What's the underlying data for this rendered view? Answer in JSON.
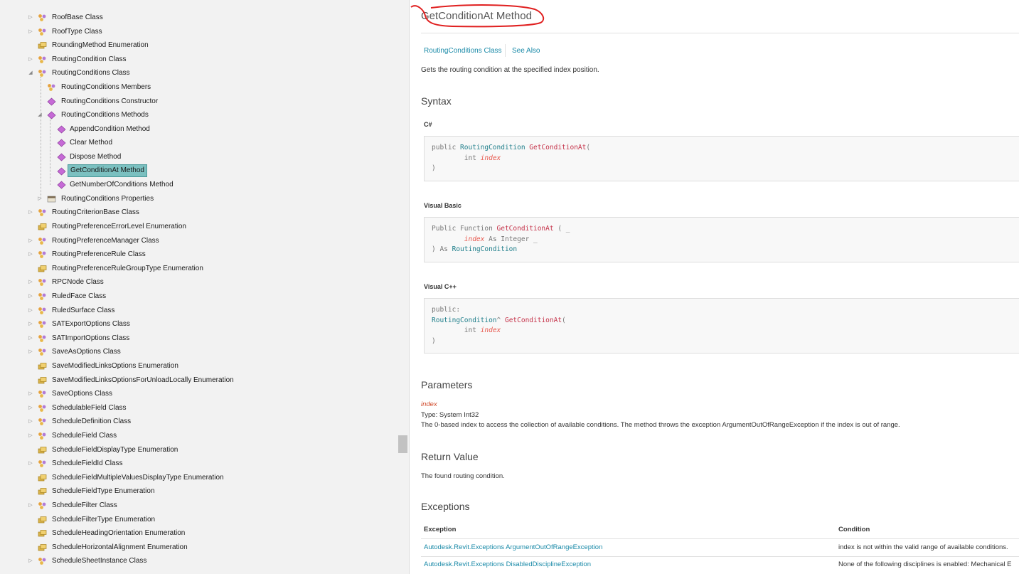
{
  "sidebar": {
    "items": [
      {
        "label": "RoofBase Class",
        "icon": "class-icon",
        "toggle": "▷",
        "level": 0
      },
      {
        "label": "RoofType Class",
        "icon": "class-icon",
        "toggle": "▷",
        "level": 0
      },
      {
        "label": "RoundingMethod Enumeration",
        "icon": "enum-icon",
        "toggle": "",
        "level": 0
      },
      {
        "label": "RoutingCondition Class",
        "icon": "class-icon",
        "toggle": "▷",
        "level": 0
      },
      {
        "label": "RoutingConditions Class",
        "icon": "class-icon",
        "toggle": "◢",
        "level": 0
      },
      {
        "label": "RoutingConditions Members",
        "icon": "class-icon",
        "toggle": "",
        "level": 1
      },
      {
        "label": "RoutingConditions Constructor",
        "icon": "method-icon",
        "toggle": "",
        "level": 1
      },
      {
        "label": "RoutingConditions Methods",
        "icon": "method-icon",
        "toggle": "◢",
        "level": 1
      },
      {
        "label": "AppendCondition Method",
        "icon": "method-icon",
        "toggle": "",
        "level": 2
      },
      {
        "label": "Clear Method",
        "icon": "method-icon",
        "toggle": "",
        "level": 2
      },
      {
        "label": "Dispose Method",
        "icon": "method-icon",
        "toggle": "",
        "level": 2
      },
      {
        "label": "GetConditionAt Method",
        "icon": "method-icon",
        "toggle": "",
        "level": 2,
        "selected": true
      },
      {
        "label": "GetNumberOfConditions Method",
        "icon": "method-icon",
        "toggle": "",
        "level": 2
      },
      {
        "label": "RoutingConditions Properties",
        "icon": "property-icon",
        "toggle": "▷",
        "level": 1
      },
      {
        "label": "RoutingCriterionBase Class",
        "icon": "class-icon",
        "toggle": "▷",
        "level": 0
      },
      {
        "label": "RoutingPreferenceErrorLevel Enumeration",
        "icon": "enum-icon",
        "toggle": "",
        "level": 0
      },
      {
        "label": "RoutingPreferenceManager Class",
        "icon": "class-icon",
        "toggle": "▷",
        "level": 0
      },
      {
        "label": "RoutingPreferenceRule Class",
        "icon": "class-icon",
        "toggle": "▷",
        "level": 0
      },
      {
        "label": "RoutingPreferenceRuleGroupType Enumeration",
        "icon": "enum-icon",
        "toggle": "",
        "level": 0
      },
      {
        "label": "RPCNode Class",
        "icon": "class-icon",
        "toggle": "▷",
        "level": 0
      },
      {
        "label": "RuledFace Class",
        "icon": "class-icon",
        "toggle": "▷",
        "level": 0
      },
      {
        "label": "RuledSurface Class",
        "icon": "class-icon",
        "toggle": "▷",
        "level": 0
      },
      {
        "label": "SATExportOptions Class",
        "icon": "class-icon",
        "toggle": "▷",
        "level": 0
      },
      {
        "label": "SATImportOptions Class",
        "icon": "class-icon",
        "toggle": "▷",
        "level": 0
      },
      {
        "label": "SaveAsOptions Class",
        "icon": "class-icon",
        "toggle": "▷",
        "level": 0
      },
      {
        "label": "SaveModifiedLinksOptions Enumeration",
        "icon": "enum-icon",
        "toggle": "",
        "level": 0
      },
      {
        "label": "SaveModifiedLinksOptionsForUnloadLocally Enumeration",
        "icon": "enum-icon",
        "toggle": "",
        "level": 0
      },
      {
        "label": "SaveOptions Class",
        "icon": "class-icon",
        "toggle": "▷",
        "level": 0
      },
      {
        "label": "SchedulableField Class",
        "icon": "class-icon",
        "toggle": "▷",
        "level": 0
      },
      {
        "label": "ScheduleDefinition Class",
        "icon": "class-icon",
        "toggle": "▷",
        "level": 0
      },
      {
        "label": "ScheduleField Class",
        "icon": "class-icon",
        "toggle": "▷",
        "level": 0
      },
      {
        "label": "ScheduleFieldDisplayType Enumeration",
        "icon": "enum-icon",
        "toggle": "",
        "level": 0
      },
      {
        "label": "ScheduleFieldId Class",
        "icon": "class-icon",
        "toggle": "▷",
        "level": 0
      },
      {
        "label": "ScheduleFieldMultipleValuesDisplayType Enumeration",
        "icon": "enum-icon",
        "toggle": "",
        "level": 0
      },
      {
        "label": "ScheduleFieldType Enumeration",
        "icon": "enum-icon",
        "toggle": "",
        "level": 0
      },
      {
        "label": "ScheduleFilter Class",
        "icon": "class-icon",
        "toggle": "▷",
        "level": 0
      },
      {
        "label": "ScheduleFilterType Enumeration",
        "icon": "enum-icon",
        "toggle": "",
        "level": 0
      },
      {
        "label": "ScheduleHeadingOrientation Enumeration",
        "icon": "enum-icon",
        "toggle": "",
        "level": 0
      },
      {
        "label": "ScheduleHorizontalAlignment Enumeration",
        "icon": "enum-icon",
        "toggle": "",
        "level": 0
      },
      {
        "label": "ScheduleSheetInstance Class",
        "icon": "class-icon",
        "toggle": "▷",
        "level": 0
      }
    ]
  },
  "page": {
    "title": "GetConditionAt Method",
    "breadcrumb": {
      "parent": "RoutingConditions Class",
      "see_also": "See Also"
    },
    "summary": "Gets the routing condition at the specified index position.",
    "syntax": {
      "heading": "Syntax",
      "csharp": {
        "label": "C#",
        "line1": {
          "kw": "public ",
          "type": "RoutingCondition",
          "name": "GetConditionAt",
          "open": "("
        },
        "line2": {
          "indent": "        ",
          "kw": "int ",
          "param": "index"
        },
        "line3": ")"
      },
      "vb": {
        "label": "Visual Basic",
        "line1": {
          "kw": "Public Function ",
          "name": "GetConditionAt",
          "rest": " ( _"
        },
        "line2": {
          "indent": "        ",
          "param": "index",
          "rest": " As Integer _"
        },
        "line3": {
          "kw": ") As ",
          "type": "RoutingCondition"
        }
      },
      "cpp": {
        "label": "Visual C++",
        "line1": "public:",
        "line2": {
          "type": "RoutingCondition",
          "hat": "^ ",
          "name": "GetConditionAt",
          "open": "("
        },
        "line3": {
          "indent": "        ",
          "kw": "int ",
          "param": "index"
        },
        "line4": ")"
      }
    },
    "parameters": {
      "heading": "Parameters",
      "name": "index",
      "type": "Type: System Int32",
      "description": "The 0-based index to access the collection of available conditions. The method throws the exception ArgumentOutOfRangeException if the index is out of range."
    },
    "return_value": {
      "heading": "Return Value",
      "text": "The found routing condition."
    },
    "exceptions": {
      "heading": "Exceptions",
      "col_exception": "Exception",
      "col_condition": "Condition",
      "rows": [
        {
          "exception": "Autodesk.Revit.Exceptions ArgumentOutOfRangeException",
          "condition": "index is not within the valid range of available conditions."
        },
        {
          "exception": "Autodesk.Revit.Exceptions DisabledDisciplineException",
          "condition": "None of the following disciplines is enabled: Mechanical E"
        }
      ]
    }
  },
  "colors": {
    "link": "#1a8aa8",
    "selection": "#7bc0c0",
    "annotation": "#e02020",
    "type": "#1e7e8a",
    "method": "#c5334a",
    "param": "#e85a4f"
  }
}
